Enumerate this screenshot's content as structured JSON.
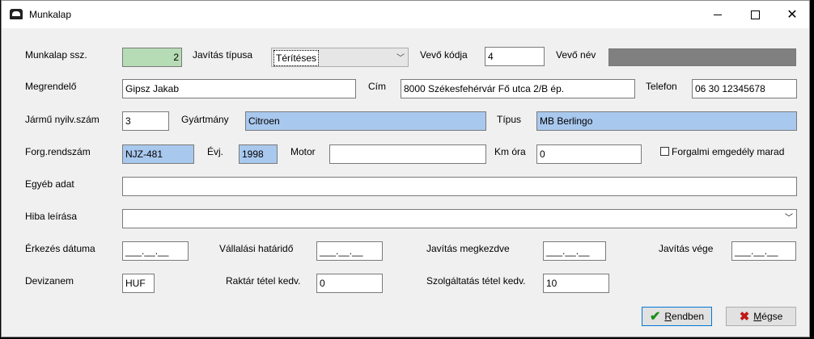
{
  "window": {
    "title": "Munkalap"
  },
  "labels": {
    "worksheet_no": "Munkalap ssz.",
    "repair_type": "Javítás típusa",
    "customer_code": "Vevő kódja",
    "customer_name": "Vevő név",
    "orderer": "Megrendelő",
    "address": "Cím",
    "phone": "Telefon",
    "vehicle_reg": "Jármű nyilv.szám",
    "manufacturer": "Gyártmány",
    "type": "Típus",
    "plate": "Forg.rendszám",
    "year": "Évj.",
    "engine": "Motor",
    "km": "Km óra",
    "keep_license": "Forgalmi emgedély marad",
    "other": "Egyéb adat",
    "fault": "Hiba leírása",
    "arrival": "Érkezés dátuma",
    "deadline": "Vállalási határidő",
    "repair_start": "Javítás megkezdve",
    "repair_end": "Javítás vége",
    "currency": "Devizanem",
    "stock_discount": "Raktár tétel kedv.",
    "service_discount": "Szolgáltatás tétel kedv."
  },
  "values": {
    "worksheet_no": "2",
    "repair_type": "Térítéses",
    "customer_code": "4",
    "customer_name": "",
    "orderer": "Gipsz Jakab",
    "address": "8000 Székesfehérvár Fő utca 2/B ép.",
    "phone": "06 30 12345678",
    "vehicle_reg": "3",
    "manufacturer": "Citroen",
    "type": "MB Berlingo",
    "plate": "NJZ-481",
    "year": "1998",
    "engine": "",
    "km": "0",
    "keep_license_checked": false,
    "other": "",
    "fault": "",
    "arrival": "___.__.__",
    "deadline": "___.__.__",
    "repair_start": "___.__.__",
    "repair_end": "___.__.__",
    "currency": "HUF",
    "stock_discount": "0",
    "service_discount": "10"
  },
  "buttons": {
    "ok_prefix": "",
    "ok_underlined": "R",
    "ok_rest": "endben",
    "cancel_underlined": "M",
    "cancel_rest": "égse"
  },
  "colors": {
    "green_field": "#b6dcb6",
    "blue_field": "#a9c8ee",
    "gray_field": "#808080"
  },
  "icons": {
    "app": "app-icon",
    "minimize": "minimize-icon",
    "maximize": "maximize-icon",
    "close": "close-icon",
    "ok": "check-icon",
    "cancel": "x-icon"
  }
}
